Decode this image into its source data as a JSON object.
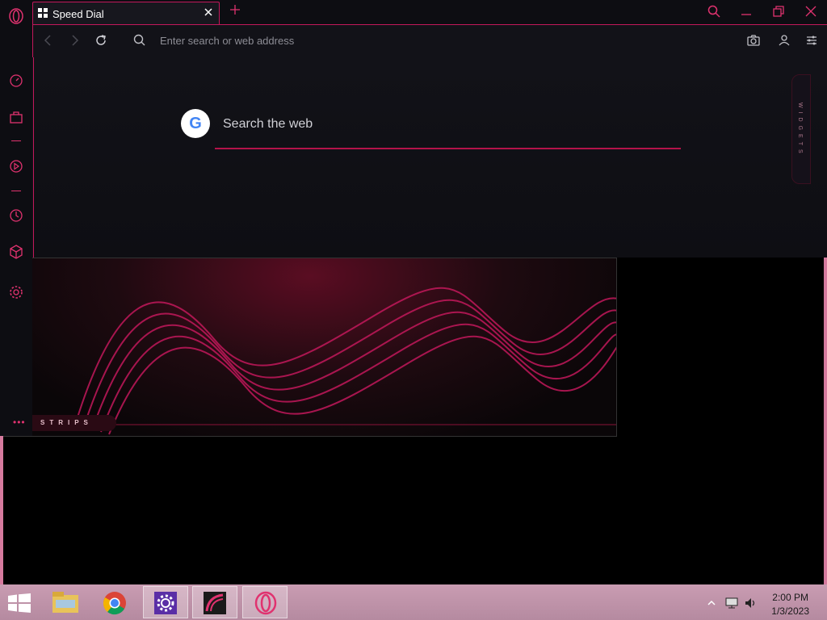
{
  "tab": {
    "title": "Speed Dial"
  },
  "toolbar": {
    "address_placeholder": "Enter search or web address"
  },
  "speed_dial": {
    "search_placeholder": "Search the web",
    "search_engine_letter": "G"
  },
  "widgets": {
    "label": "WIDGETS"
  },
  "strips": {
    "label": "STRIPS",
    "more": "•••"
  },
  "taskbar": {
    "time": "2:00 PM",
    "date": "1/3/2023"
  },
  "colors": {
    "accent": "#e0326f",
    "background": "#121218",
    "taskbar": "#c99cb2"
  }
}
